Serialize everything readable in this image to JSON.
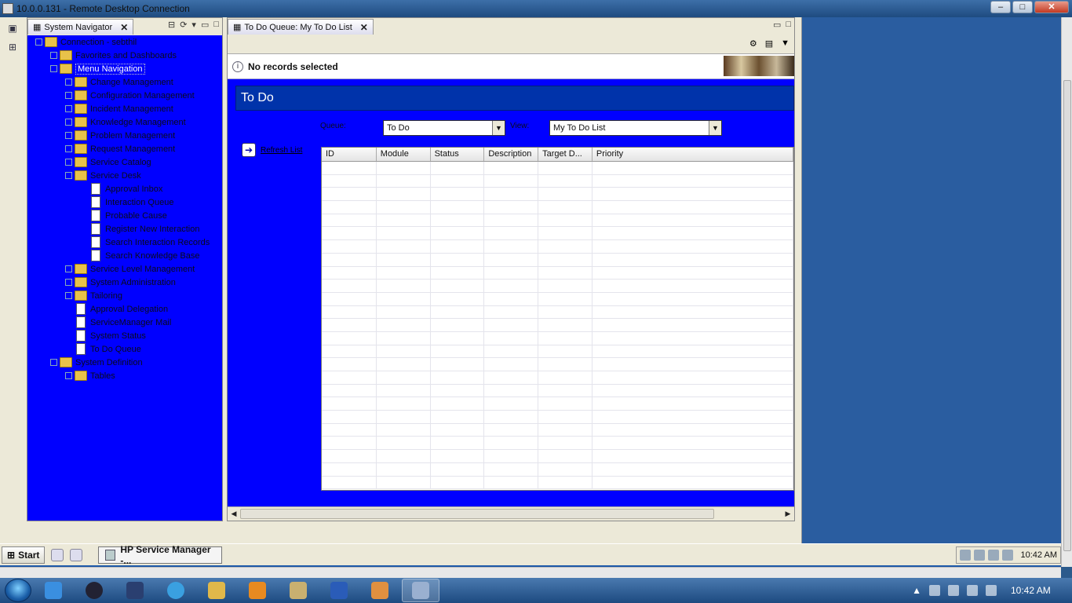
{
  "rdp": {
    "title": "10.0.0.131 - Remote Desktop Connection",
    "min_label": "–",
    "max_label": "□",
    "close_label": "✕"
  },
  "nav": {
    "tab_label": "System Navigator",
    "tab_close": "✕",
    "items": [
      {
        "label": "Connection - sebthil",
        "level": 0,
        "type": "folder"
      },
      {
        "label": "Favorites and Dashboards",
        "level": 1,
        "type": "folder"
      },
      {
        "label": "Menu Navigation",
        "level": 1,
        "type": "folder",
        "selected": true
      },
      {
        "label": "Change Management",
        "level": 2,
        "type": "folder"
      },
      {
        "label": "Configuration Management",
        "level": 2,
        "type": "folder"
      },
      {
        "label": "Incident Management",
        "level": 2,
        "type": "folder"
      },
      {
        "label": "Knowledge Management",
        "level": 2,
        "type": "folder"
      },
      {
        "label": "Problem Management",
        "level": 2,
        "type": "folder"
      },
      {
        "label": "Request Management",
        "level": 2,
        "type": "folder"
      },
      {
        "label": "Service Catalog",
        "level": 2,
        "type": "folder"
      },
      {
        "label": "Service Desk",
        "level": 2,
        "type": "folder"
      },
      {
        "label": "Approval Inbox",
        "level": 3,
        "type": "doc"
      },
      {
        "label": "Interaction Queue",
        "level": 3,
        "type": "doc"
      },
      {
        "label": "Probable Cause",
        "level": 3,
        "type": "doc"
      },
      {
        "label": "Register New Interaction",
        "level": 3,
        "type": "doc"
      },
      {
        "label": "Search Interaction Records",
        "level": 3,
        "type": "doc"
      },
      {
        "label": "Search Knowledge Base",
        "level": 3,
        "type": "doc"
      },
      {
        "label": "Service Level Management",
        "level": 2,
        "type": "folder"
      },
      {
        "label": "System Administration",
        "level": 2,
        "type": "folder"
      },
      {
        "label": "Tailoring",
        "level": 2,
        "type": "folder"
      },
      {
        "label": "Approval Delegation",
        "level": 2,
        "type": "doc"
      },
      {
        "label": "ServiceManager Mail",
        "level": 2,
        "type": "doc"
      },
      {
        "label": "System Status",
        "level": 2,
        "type": "doc"
      },
      {
        "label": "To Do Queue",
        "level": 2,
        "type": "doc"
      },
      {
        "label": "System Definition",
        "level": 1,
        "type": "folder"
      },
      {
        "label": "Tables",
        "level": 2,
        "type": "folder"
      }
    ]
  },
  "todo": {
    "tab_label": "To Do Queue: My To Do List",
    "tab_close": "✕",
    "message": "No records selected",
    "heading": "To Do",
    "queue_label": "Queue:",
    "queue_value": "To Do",
    "view_label": "View:",
    "view_value": "My To Do List",
    "refresh_label": "Refresh List",
    "columns": [
      "ID",
      "Module",
      "Status",
      "Description",
      "Target D...",
      "Priority"
    ]
  },
  "taskbar": {
    "start_label": "Start",
    "app_label": "HP Service Manager -...",
    "clock": "10:42 AM"
  },
  "win7": {
    "clock": "10:42 AM"
  }
}
